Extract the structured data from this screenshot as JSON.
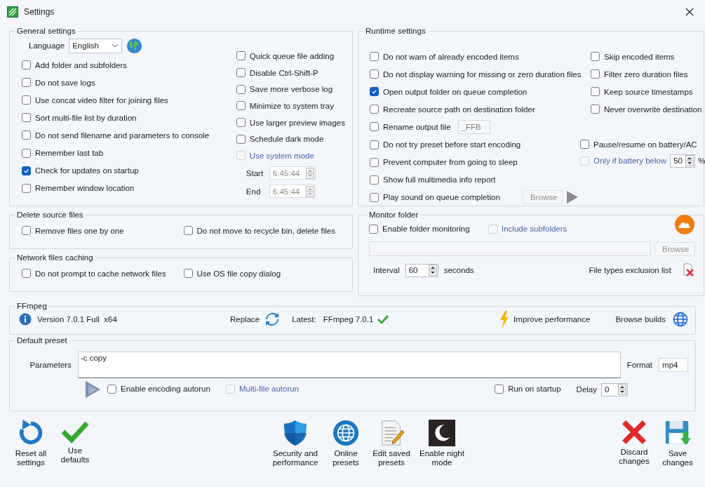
{
  "window": {
    "title": "Settings"
  },
  "general": {
    "title": "General settings",
    "language": {
      "label": "Language",
      "value": "English"
    },
    "left_checks": [
      {
        "label": "Add folder and subfolders",
        "checked": false,
        "disabled": false
      },
      {
        "label": "Do not save logs",
        "checked": false,
        "disabled": false
      },
      {
        "label": "Use concat video filter for joining files",
        "checked": false,
        "disabled": false
      },
      {
        "label": "Sort multi-file list by duration",
        "checked": false,
        "disabled": false
      },
      {
        "label": "Do not send filename and parameters to console",
        "checked": false,
        "disabled": false
      },
      {
        "label": "Remember last tab",
        "checked": false,
        "disabled": false
      },
      {
        "label": "Check for updates on startup",
        "checked": true,
        "disabled": false
      },
      {
        "label": "Remember window location",
        "checked": false,
        "disabled": false
      }
    ],
    "right_checks": [
      {
        "label": "Quick queue file adding",
        "checked": false,
        "disabled": false
      },
      {
        "label": "Disable Ctrl-Shift-P",
        "checked": false,
        "disabled": false
      },
      {
        "label": "Save more verbose log",
        "checked": false,
        "disabled": false
      },
      {
        "label": "Minimize to system tray",
        "checked": false,
        "disabled": false
      },
      {
        "label": "Use larger preview images",
        "checked": false,
        "disabled": false
      },
      {
        "label": "Schedule dark mode",
        "checked": false,
        "disabled": false
      },
      {
        "label": "Use system mode",
        "checked": false,
        "disabled": true
      }
    ],
    "times": [
      {
        "label": "Start",
        "value": "6:45:44",
        "disabled": true
      },
      {
        "label": "End",
        "value": "6:45:44",
        "disabled": true
      }
    ]
  },
  "runtime": {
    "title": "Runtime settings",
    "left_checks": [
      {
        "kind": "check",
        "label": "Do not warn of already encoded items",
        "checked": false,
        "disabled": false
      },
      {
        "kind": "check",
        "label": "Do not display warning for missing or zero duration files",
        "checked": false,
        "disabled": false
      },
      {
        "kind": "check",
        "label": "Open output folder on queue completion",
        "checked": true,
        "disabled": false
      },
      {
        "kind": "check",
        "label": "Recreate source path on destination folder",
        "checked": false,
        "disabled": false
      },
      {
        "kind": "field",
        "label": "Rename output file",
        "checked": false,
        "disabled": false,
        "value": "_FFB"
      },
      {
        "kind": "check",
        "label": "Do not try preset before start encoding",
        "checked": false,
        "disabled": false
      },
      {
        "kind": "check",
        "label": "Prevent computer from going to sleep",
        "checked": false,
        "disabled": false
      },
      {
        "kind": "check",
        "label": "Show full multimedia info report",
        "checked": false,
        "disabled": false
      },
      {
        "kind": "sound",
        "label": "Play sound on queue completion",
        "checked": false,
        "disabled": false,
        "button": "Browse",
        "button_disabled": true
      }
    ],
    "right_checks": [
      {
        "label": "Skip encoded items",
        "checked": false,
        "disabled": false
      },
      {
        "label": "Filter zero duration files",
        "checked": false,
        "disabled": false
      },
      {
        "label": "Keep source timestamps",
        "checked": false,
        "disabled": false
      },
      {
        "label": "Never overwrite destination",
        "checked": false,
        "disabled": false
      }
    ],
    "pause": {
      "label": "Pause/resume on battery/AC",
      "checked": false,
      "disabled": false
    },
    "battery": {
      "label": "Only if battery below",
      "checked": false,
      "disabled": true,
      "value": "50",
      "unit": "%"
    }
  },
  "delete_source": {
    "title": "Delete source files",
    "checks": [
      {
        "label": "Remove files one by one",
        "checked": false,
        "disabled": false
      },
      {
        "label": "Do not move to recycle bin, delete files",
        "checked": false,
        "disabled": false
      }
    ]
  },
  "network": {
    "title": "Network files caching",
    "checks": [
      {
        "label": "Do not prompt to cache network files",
        "checked": false,
        "disabled": false
      },
      {
        "label": "Use OS file copy dialog",
        "checked": false,
        "disabled": false
      }
    ]
  },
  "monitor": {
    "title": "Monitor folder",
    "checks": [
      {
        "label": "Enable folder monitoring",
        "checked": false,
        "disabled": false
      },
      {
        "label": "Include subfolders",
        "checked": false,
        "disabled": true
      }
    ],
    "browse": {
      "label": "Browse",
      "disabled": true
    },
    "interval": {
      "label": "Interval",
      "value": "60",
      "unit": "seconds"
    },
    "exclusion": "File types exclusion list"
  },
  "ffmpeg": {
    "title": "FFmpeg",
    "version": "Version 7.0.1 Full  x64",
    "replace": "Replace",
    "latest_label": "Latest:",
    "latest_value": "FFmpeg 7.0.1",
    "improve": "Improve performance",
    "browse_builds": "Browse builds"
  },
  "preset": {
    "title": "Default preset",
    "parameters": {
      "label": "Parameters",
      "value": "-c copy"
    },
    "format": {
      "label": "Format",
      "value": "mp4"
    },
    "checks": [
      {
        "label": "Enable encoding autorun",
        "checked": false,
        "disabled": false
      },
      {
        "label": "Multi-file autorun",
        "checked": false,
        "disabled": true
      }
    ],
    "run_on_startup": {
      "label": "Run on startup",
      "checked": false,
      "disabled": false
    },
    "delay": {
      "label": "Delay",
      "value": "0"
    }
  },
  "actions": {
    "left": [
      "Reset all settings",
      "Use defaults"
    ],
    "center": [
      "Security and performance",
      "Online presets",
      "Edit saved presets",
      "Enable night mode"
    ],
    "right": [
      "Discard changes",
      "Save changes"
    ]
  }
}
